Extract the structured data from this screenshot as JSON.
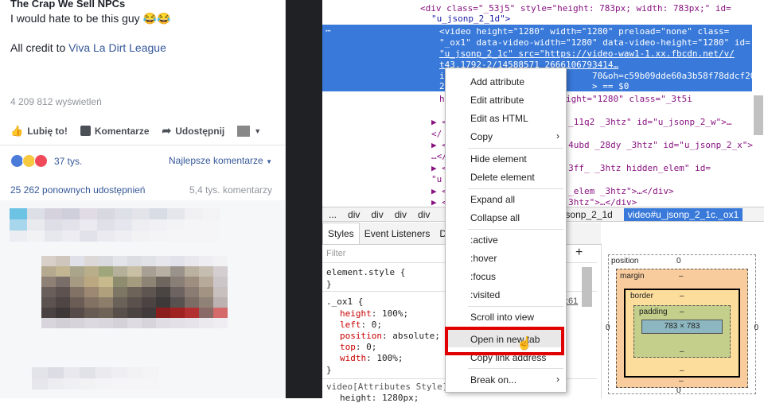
{
  "post": {
    "title": "The Crap We Sell NPCs",
    "line1": "I would hate to be this guy 😂😂",
    "credit_prefix": "All credit to ",
    "credit_link": "Viva La Dirt League",
    "views": "4 209 812 wyświetleń",
    "like_label": "Lubię to!",
    "comment_label": "Komentarze",
    "share_label": "Udostępnij",
    "reactions_count": "37 tys.",
    "sort_label": "Najlepsze komentarze",
    "shares": "25 262 ponownych udostępnień",
    "comments_count": "5,4 tys. komentarzy"
  },
  "devtools": {
    "line0": "<div class=\"_53j5\" style=\"height: 783px; width: 783px;\" id=",
    "line0b": "\"u_jsonp_2_1d\">",
    "sel1": "<video height=\"1280\" width=\"1280\" preload=\"none\" class=",
    "sel2": "\"_ox1\" data-video-width=\"1280\" data-video-height=\"1280\" id=",
    "sel3": "\"u_jsonp_2_1c\" src=\"https://video-waw1-1.xx.fbcdn.net/v/",
    "sel4": "t43.1792-2/14588571_2666106793414…",
    "sel5": "i                            70&oh=c59b09dde60a3b58f78ddcf208434",
    "sel6": "2                            > == $0",
    "after1": "h                       ight=\"1280\" class=\"_3t5i",
    "after2": "▶ <                       _11q2 _3htz\" id=\"u_jsonp_2_w\">…",
    "after3": "</                      ",
    "after4": "▶ <                       4ubd _28dy _3htz\" id=\"u_jsonp_2_x\">",
    "after5": "…</                     ",
    "after6": "▶ <                       3ff_ _3htz hidden_elem\" id=",
    "after7": "\"u                      ",
    "after8": "▶ <                       _elem _3htz\">…</div>",
    "after9": "▶ <                       3htz\">…</div>",
    "crumbs": [
      "...",
      "div",
      "div",
      "div",
      "div"
    ],
    "crumb_mid": "u_jsonp_2_1d",
    "crumb_active": "video#u_jsonp_2_1c._ox1",
    "tabs": [
      "Styles",
      "Event Listeners",
      "DO"
    ],
    "filter_placeholder": "Filter",
    "styles": {
      "element_style": "element.style {",
      "close": "}",
      "rule_sel": "._ox1 {",
      "props": [
        {
          "name": "height",
          "value": "100%;"
        },
        {
          "name": "left",
          "value": "0;"
        },
        {
          "name": "position",
          "value": "absolute;"
        },
        {
          "name": "top",
          "value": "0;"
        },
        {
          "name": "width",
          "value": "100%;"
        }
      ],
      "source_link": ":61",
      "video_attr": "video[Attributes Style]",
      "height_prop": "height: 1280px;"
    },
    "boxmodel": {
      "position_label": "position",
      "position_val": "0",
      "margin_label": "margin",
      "margin_val": "–",
      "border_label": "border",
      "border_val": "–",
      "padding_label": "padding",
      "padding_val": "–",
      "content": "783 × 783",
      "side0": "0",
      "dash": "–"
    }
  },
  "menu": {
    "items": [
      "Add attribute",
      "Edit attribute",
      "Edit as HTML",
      "Copy",
      "Hide element",
      "Delete element",
      "Expand all",
      "Collapse all",
      ":active",
      ":hover",
      ":focus",
      ":visited",
      "Scroll into view",
      "Open in new tab",
      "Copy link address",
      "Break on..."
    ]
  },
  "colors": {
    "fb_blue": "#365899",
    "selection": "#3879d9",
    "highlight_red": "#e00000"
  }
}
